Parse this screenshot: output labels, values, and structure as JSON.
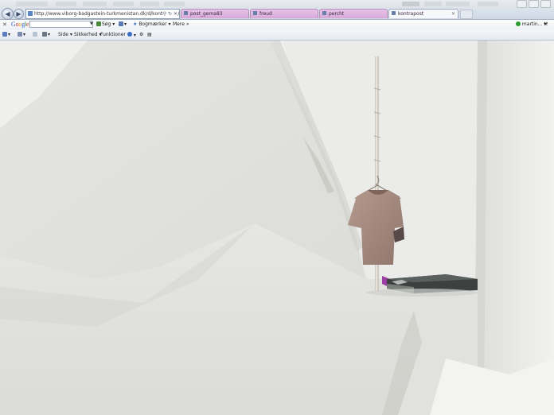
{
  "browser": {
    "address_url": "http://www.viborg-badgastein-turkmenistan.dk/d/kontrapost/",
    "tabs": [
      {
        "label": "post_gema83",
        "active": false
      },
      {
        "label": "freud",
        "active": false
      },
      {
        "label": "percht",
        "active": false
      },
      {
        "label": "kontrapost",
        "active": true
      }
    ]
  },
  "google_toolbar": {
    "logo": "Google",
    "search_placeholder": "",
    "search_button": "Søg",
    "bookmarks_label": "Bogmærker",
    "more_label": "Mere",
    "user_label": "martin..."
  },
  "command_bar": {
    "page_label": "Side",
    "security_label": "Sikkerhed",
    "tools_label": "Funktioner"
  },
  "colors": {
    "tab_inactive": "#d8a9d9",
    "tab_active": "#f6f8fb",
    "page_background": "#e9ebe8",
    "status_online": "#2e9a2e"
  },
  "icons": [
    "back-arrow-icon",
    "forward-arrow-icon",
    "search-icon",
    "refresh-icon",
    "close-icon",
    "star-icon",
    "help-icon",
    "print-icon",
    "home-icon",
    "mail-icon",
    "wrench-icon"
  ]
}
